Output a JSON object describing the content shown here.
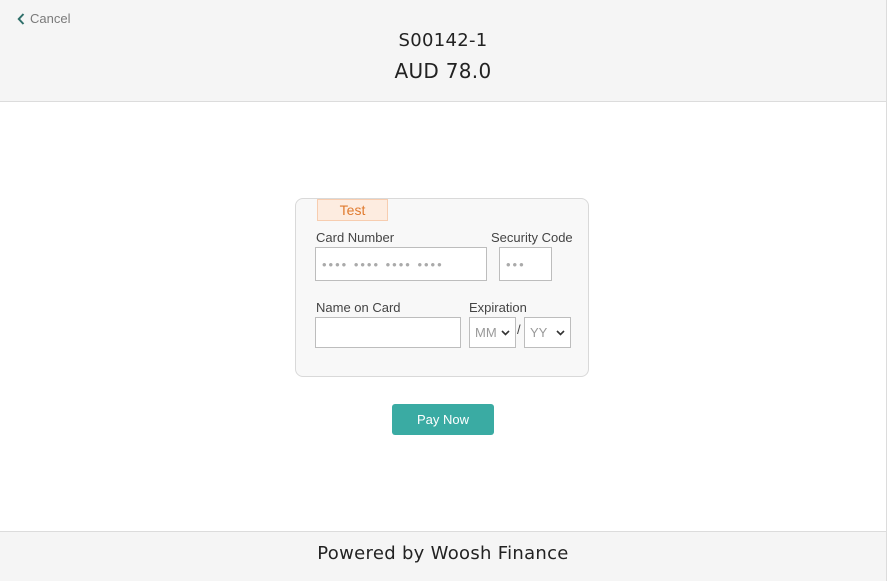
{
  "header": {
    "cancel_label": "Cancel",
    "cancel_icon": "chevron-left-icon",
    "order_id": "S00142-1",
    "amount": "AUD 78.0"
  },
  "form": {
    "badge": "Test",
    "card_number_label": "Card Number",
    "card_number_placeholder": "•••• •••• •••• ••••",
    "security_code_label": "Security Code",
    "security_code_placeholder": "•••",
    "name_label": "Name on Card",
    "name_value": "",
    "expiration_label": "Expiration",
    "month_selected": "MM",
    "year_selected": "YY",
    "separator": "/"
  },
  "pay_button_label": "Pay Now",
  "footer": {
    "text": "Powered by Woosh Finance"
  },
  "colors": {
    "accent": "#3aaba3",
    "badge_text": "#e07a2e",
    "badge_bg": "#fdece0",
    "cancel_icon": "#2f6f6a"
  }
}
